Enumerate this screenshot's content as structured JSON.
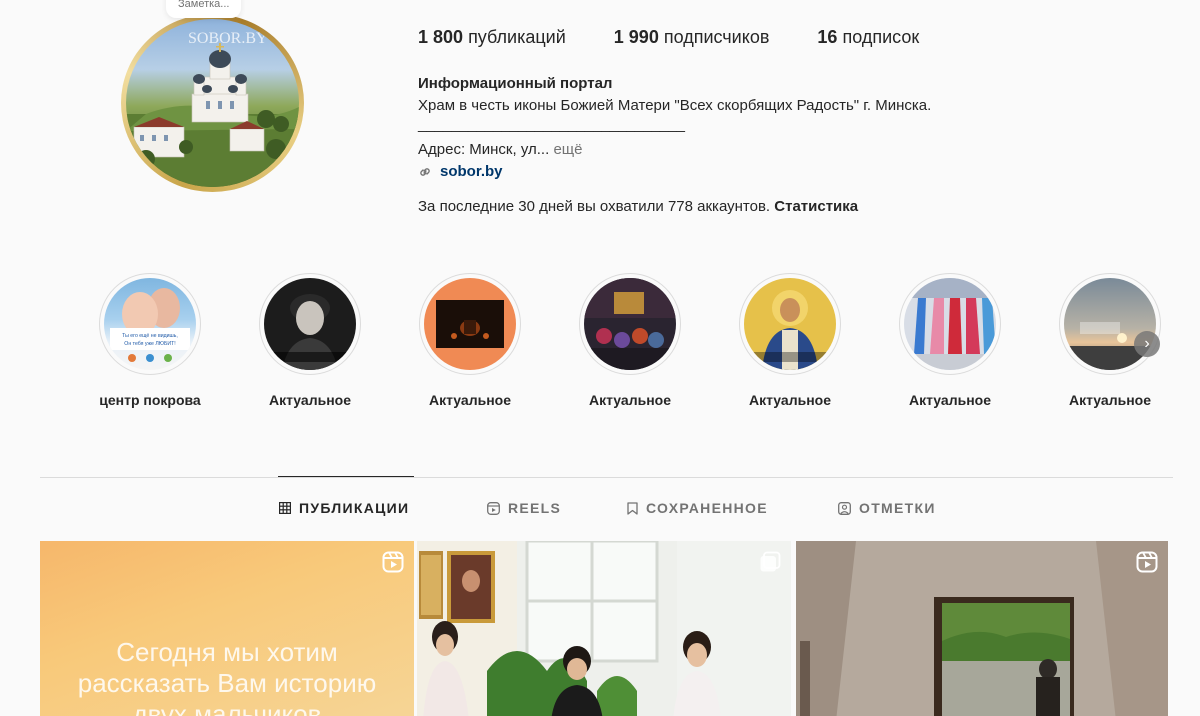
{
  "profile": {
    "note_bubble": "Заметка...",
    "avatar_watermark": "SOBOR.BY",
    "stats": {
      "posts_count": "1 800",
      "posts_label": "публикаций",
      "followers_count": "1 990",
      "followers_label": "подписчиков",
      "following_count": "16",
      "following_label": "подписок"
    },
    "bio": {
      "name": "Информационный портал",
      "line1": "Храм в честь иконы Божией Матери \"Всех скорбящих Радость\" г. Минска.",
      "line2": "________________________________",
      "address": "Адрес: Минск, ул...",
      "more": "ещё",
      "link": "sobor.by"
    },
    "reach": {
      "text": "За последние 30 дней вы охватили 778 аккаунтов.",
      "stats_link": "Статистика"
    }
  },
  "highlights": [
    {
      "label": "центр покрова",
      "icon": "highlight-cover-pokrov"
    },
    {
      "label": "Актуальное",
      "icon": "highlight-cover-portrait"
    },
    {
      "label": "Актуальное",
      "icon": "highlight-cover-night"
    },
    {
      "label": "Актуальное",
      "icon": "highlight-cover-church-interior"
    },
    {
      "label": "Актуальное",
      "icon": "highlight-cover-icon-saint"
    },
    {
      "label": "Актуальное",
      "icon": "highlight-cover-flags"
    },
    {
      "label": "Актуальное",
      "icon": "highlight-cover-sky"
    }
  ],
  "highlight_cover_texts": {
    "pokrov_line1": "Ты его ещё не видишь,",
    "pokrov_line2": "Он тебя уже ЛЮБИТ!"
  },
  "tabs": [
    {
      "label": "ПУБЛИКАЦИИ",
      "icon": "grid-icon",
      "active": true
    },
    {
      "label": "REELS",
      "icon": "reels-icon",
      "active": false
    },
    {
      "label": "СОХРАНЕННОЕ",
      "icon": "bookmark-icon",
      "active": false
    },
    {
      "label": "ОТМЕТКИ",
      "icon": "tagged-icon",
      "active": false
    }
  ],
  "posts": {
    "post1_text_line1": "Сегодня мы хотим",
    "post1_text_line2": "рассказать Вам историю",
    "post1_text_line3": "двух мальчиков"
  },
  "colors": {
    "link": "#00376b",
    "muted": "#737373",
    "text": "#262626",
    "avatar_ring": "#c9a54a"
  }
}
